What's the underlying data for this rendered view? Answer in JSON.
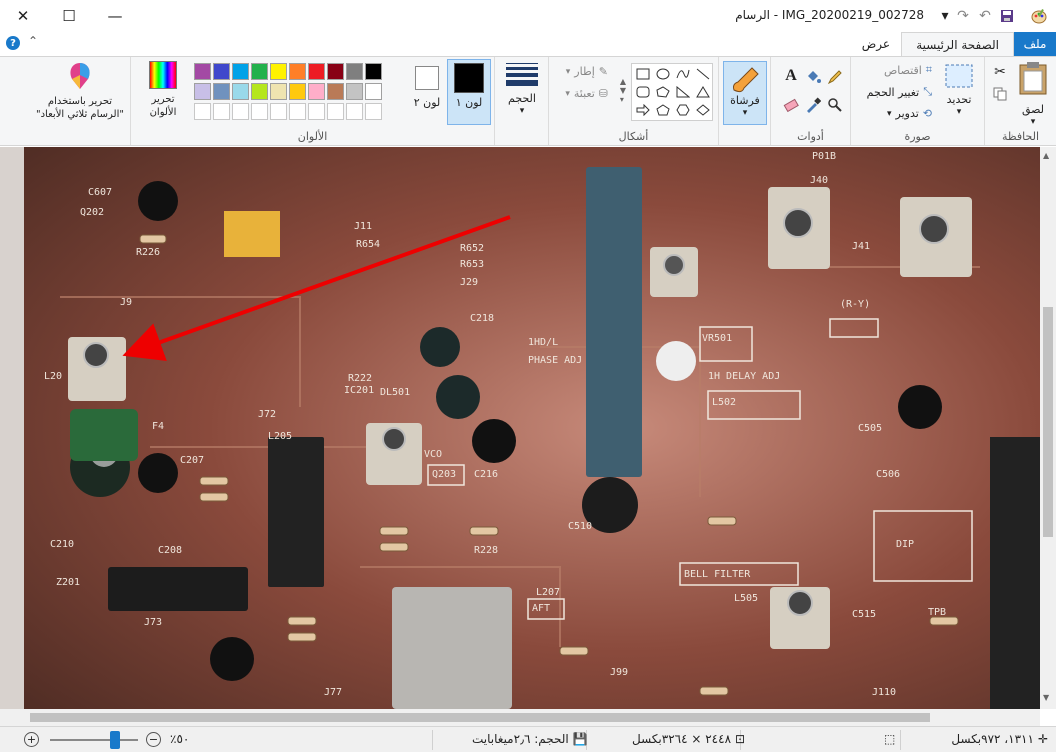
{
  "window": {
    "title": "IMG_20200219_002728 - الرسام",
    "minimize": "—",
    "maximize": "☐",
    "close": "✕"
  },
  "tabs": {
    "file": "ملف",
    "home": "الصفحة الرئيسية",
    "view": "عرض"
  },
  "ribbon": {
    "clipboard": {
      "label": "الحافظة",
      "paste": "لصق"
    },
    "image": {
      "label": "صورة",
      "select": "تحديد",
      "crop": "اقتصاص",
      "resize": "تغيير الحجم",
      "rotate": "تدوير"
    },
    "tools": {
      "label": "أدوات"
    },
    "brushes": {
      "label": "فرشاة"
    },
    "shapes": {
      "label": "أشكال",
      "outline": "إطار",
      "fill": "تعبئة"
    },
    "size": {
      "label": "الحجم"
    },
    "colors": {
      "label": "الألوان",
      "color1": "لون ١",
      "color2": "لون ٢",
      "edit_colors": "تحرير الألوان",
      "paint3d": "تحرير باستخدام \"الرسام ثلاثي الأبعاد\"",
      "color1_value": "#000000",
      "color2_value": "#ffffff",
      "palette_row1": [
        "#000000",
        "#7f7f7f",
        "#880015",
        "#ed1c24",
        "#ff7f27",
        "#fff200",
        "#22b14c",
        "#00a2e8",
        "#3f48cc",
        "#a349a4"
      ],
      "palette_row2": [
        "#ffffff",
        "#c3c3c3",
        "#b97a57",
        "#ffaec9",
        "#ffc90e",
        "#efe4b0",
        "#b5e61d",
        "#99d9ea",
        "#7092be",
        "#c8bfe7"
      ]
    }
  },
  "canvas": {
    "pcb_labels": [
      "C607",
      "Q202",
      "R226",
      "J9",
      "L20",
      "F4",
      "C207",
      "C210",
      "Z201",
      "C208",
      "J11",
      "R654",
      "R652",
      "R653",
      "J29",
      "C218",
      "R222",
      "IC201",
      "L205",
      "VCO",
      "Q203",
      "C216",
      "DL501",
      "1HD/L",
      "PHASE ADJ",
      "VR501",
      "1H DELAY ADJ",
      "L502",
      "(R-Y)",
      "J40",
      "J41",
      "C505",
      "C506",
      "DIP",
      "BELL FILTER",
      "L505",
      "AFT",
      "L207",
      "C510",
      "C515",
      "TPB",
      "J77",
      "J99",
      "J110",
      "P01B",
      "J73",
      "J72",
      "R228"
    ]
  },
  "status": {
    "cursor": "١٣١١، ٩٧٢بكسل",
    "selection": "",
    "dimensions": "٢٤٤٨ × ٣٢٦٤بكسل",
    "size": "الحجم: ٢٫٦ميغابايت",
    "zoom": "٥٠٪"
  }
}
